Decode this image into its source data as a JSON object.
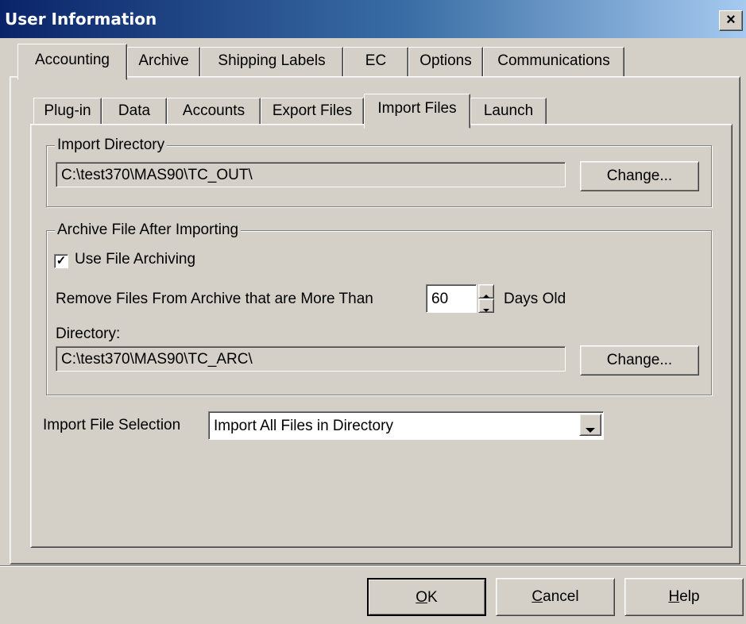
{
  "window": {
    "title": "User Information",
    "close_glyph": "×"
  },
  "top_tabs": [
    "Accounting",
    "Archive",
    "Shipping Labels",
    "EC",
    "Options",
    "Communications"
  ],
  "sub_tabs": [
    "Plug-in",
    "Data",
    "Accounts",
    "Export Files",
    "Import Files",
    "Launch"
  ],
  "active_top_tab": "Accounting",
  "active_sub_tab": "Import Files",
  "import_directory": {
    "legend": "Import Directory",
    "path": "C:\\test370\\MAS90\\TC_OUT\\",
    "change_label": "Change..."
  },
  "archive": {
    "legend": "Archive File After Importing",
    "use_archiving_label": "Use File Archiving",
    "use_archiving_checked": true,
    "checkmark": "✓",
    "remove_label": "Remove Files From Archive that are More Than",
    "days_value": "60",
    "days_suffix": "Days Old",
    "directory_label": "Directory:",
    "directory_path": "C:\\test370\\MAS90\\TC_ARC\\",
    "change_label": "Change..."
  },
  "import_selection": {
    "label": "Import File Selection",
    "value": "Import All Files in Directory"
  },
  "footer": {
    "ok_underline": "O",
    "ok_rest": "K",
    "cancel_underline": "C",
    "cancel_rest": "ancel",
    "help_underline": "H",
    "help_rest": "elp"
  }
}
